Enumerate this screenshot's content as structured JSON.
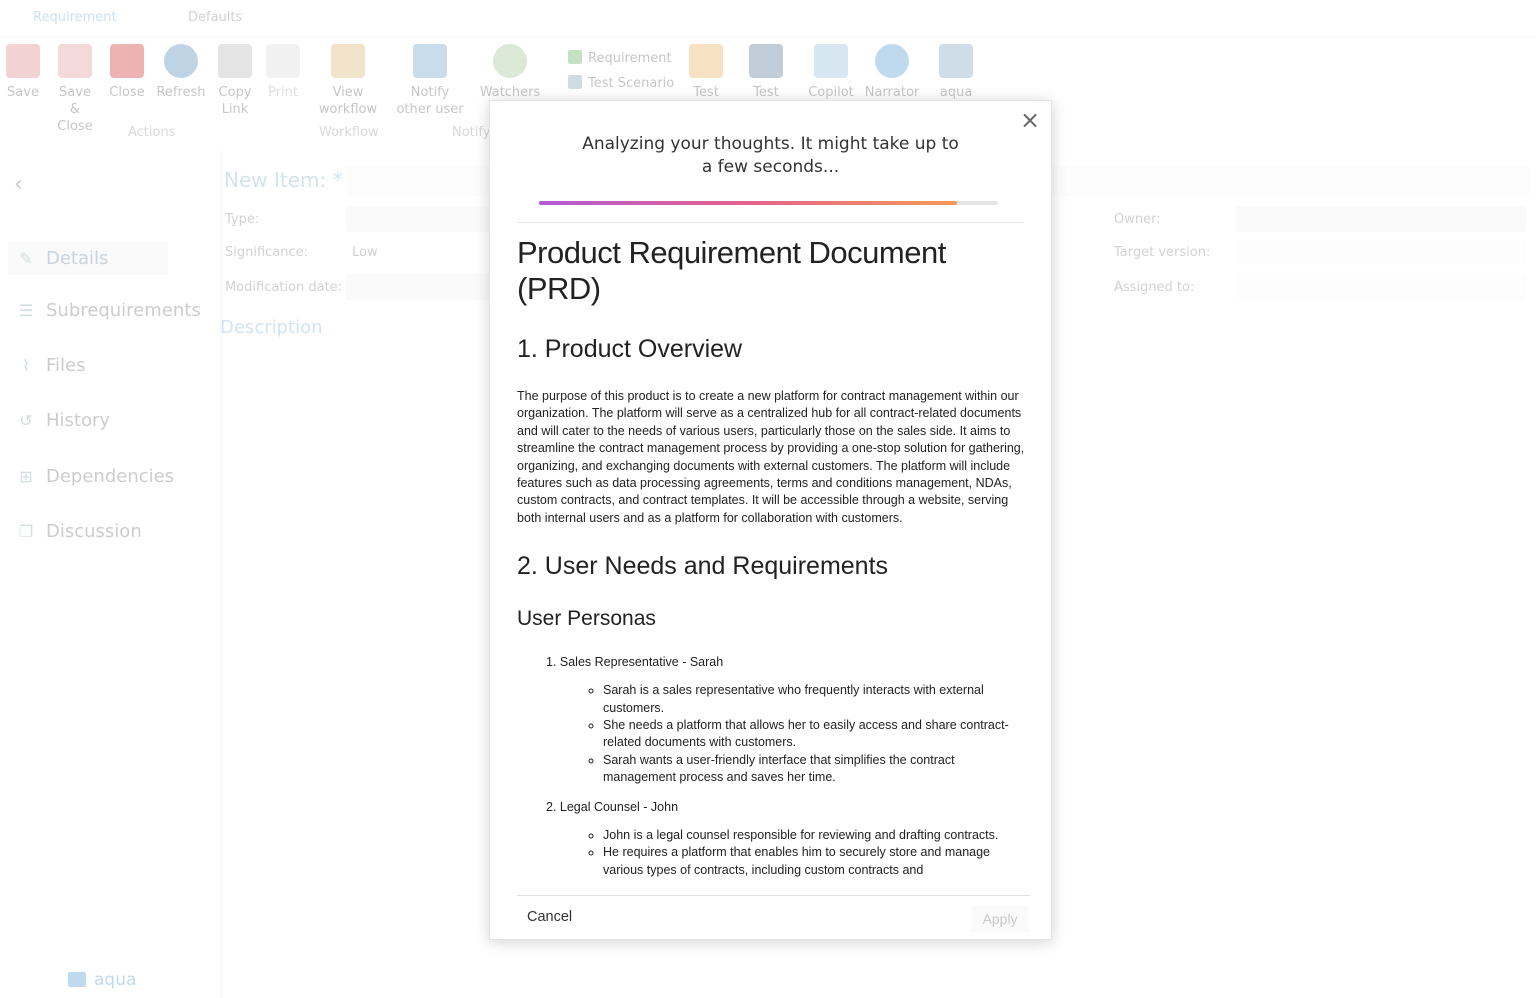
{
  "tabs": [
    "Requirement",
    "Defaults"
  ],
  "ribbon": {
    "save": "Save",
    "save_close_1": "Save &",
    "save_close_2": "Close",
    "close": "Close",
    "refresh": "Refresh",
    "copy_link_1": "Copy",
    "copy_link_2": "Link",
    "print": "Print",
    "view_workflow_1": "View",
    "view_workflow_2": "workflow",
    "notify_1": "Notify",
    "notify_2": "other user",
    "watchers": "Watchers",
    "requirement": "Requirement",
    "test_scenario": "Test Scenario",
    "test1": "Test",
    "test2": "Test",
    "copilot": "Copilot",
    "narrator": "Narrator",
    "aqua": "aqua",
    "group_actions": "Actions",
    "group_workflow": "Workflow",
    "group_notify": "Notify"
  },
  "sidebar": {
    "items": [
      "Details",
      "Subrequirements",
      "Files",
      "History",
      "Dependencies",
      "Discussion"
    ],
    "footer": "aqua"
  },
  "form": {
    "new_item": "New Item: *",
    "type": "Type:",
    "significance": "Significance:",
    "significance_value": "Low",
    "modification_date": "Modification date:",
    "owner": "Owner:",
    "target_version": "Target version:",
    "assigned_to": "Assigned to:",
    "description": "Description"
  },
  "modal": {
    "status_line1": "Analyzing your thoughts. It might take up to",
    "status_line2": "a few seconds...",
    "progress": 0.91,
    "doc_title": "Product Requirement Document (PRD)",
    "section1": "1. Product Overview",
    "overview": "The purpose of this product is to create a new platform for contract management within our organization. The platform will serve as a centralized hub for all contract-related documents and will cater to the needs of various users, particularly those on the sales side. It aims to streamline the contract management process by providing a one-stop solution for gathering, organizing, and exchanging documents with external customers. The platform will include features such as data processing agreements, terms and conditions management, NDAs, custom contracts, and contract templates. It will be accessible through a website, serving both internal users and as a platform for collaboration with customers.",
    "section2": "2. User Needs and Requirements",
    "personas_title": "User Personas",
    "persona1": "1. Sales Representative - Sarah",
    "persona1_bullets": [
      "Sarah is a sales representative who frequently interacts with external customers.",
      "She needs a platform that allows her to easily access and share contract-related documents with customers.",
      "Sarah wants a user-friendly interface that simplifies the contract management process and saves her time."
    ],
    "persona2": "2. Legal Counsel - John",
    "persona2_bullets": [
      "John is a legal counsel responsible for reviewing and drafting contracts.",
      "He requires a platform that enables him to securely store and manage various types of contracts, including custom contracts and"
    ],
    "cancel": "Cancel",
    "apply": "Apply"
  }
}
